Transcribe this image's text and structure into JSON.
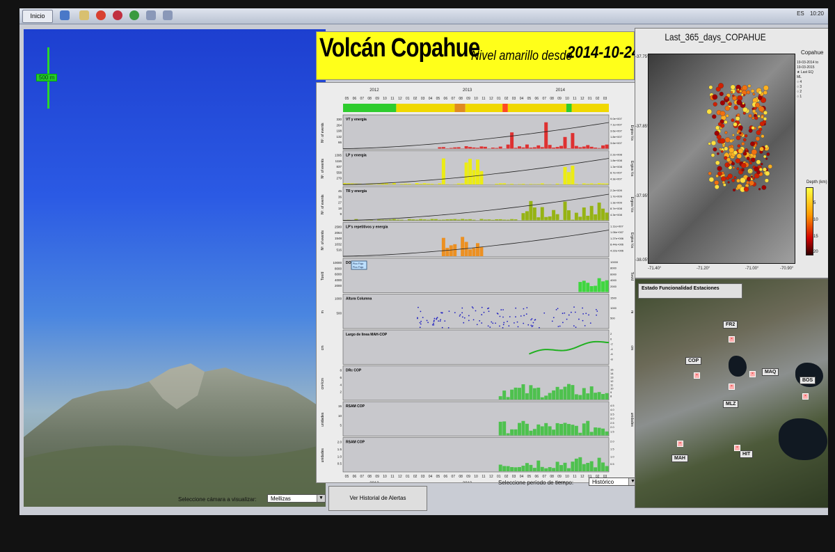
{
  "taskbar": {
    "start_label": "Inicio",
    "lang": "ES",
    "clock": "10:20"
  },
  "camera": {
    "scale_label": "500 m",
    "select_label": "Seleccione cámara a visualizar:",
    "select_value": "Mellizas"
  },
  "header": {
    "title": "Volcán Copahue",
    "subtitle": "Nivel amarillo desde",
    "date": "2014-10-24"
  },
  "controls": {
    "history_button": "Ver Historial de Alertas",
    "period_label": "Seleccione período de tiempo:",
    "period_value": "Histórico"
  },
  "chart_data": {
    "type": "line",
    "years_top": [
      "2012",
      "2013",
      "2014"
    ],
    "months_top": [
      "05",
      "06",
      "07",
      "08",
      "09",
      "10",
      "11",
      "12",
      "01",
      "02",
      "03",
      "04",
      "05",
      "06",
      "07",
      "08",
      "09",
      "10",
      "11",
      "12",
      "01",
      "02",
      "03",
      "04",
      "05",
      "06",
      "07",
      "08",
      "09",
      "10",
      "11",
      "12",
      "01",
      "02",
      "03"
    ],
    "alert_band": {
      "colors": [
        "#2ecc2e",
        "#f0d800",
        "#e08a20",
        "#f0d800",
        "#ff4a20",
        "#f0d800",
        "#2ecc2e",
        "#f0d800"
      ],
      "widths": [
        0.2,
        0.22,
        0.04,
        0.14,
        0.02,
        0.22,
        0.02,
        0.14
      ]
    },
    "panels": [
      {
        "label": "VT y energía",
        "ylabel": "Nº. of events",
        "yticks": [
          "330",
          "264",
          "198",
          "132",
          "66"
        ],
        "rticks": [
          "9.0e+007",
          "7.1e+007",
          "3.6e+007",
          "1.8e+007",
          "3.6e+007"
        ],
        "rlabel": "Ergios ½s",
        "color": "#e02020",
        "pattern": "spikes_right",
        "cumulative": true
      },
      {
        "label": "LP y energía",
        "ylabel": "Nº. of events",
        "yticks": [
          "1395",
          "1116",
          "837",
          "558",
          "279"
        ],
        "rticks": [
          "2.2e+008",
          "1.8e+008",
          "1.3e+008",
          "8.7e+007",
          "4.3e+007"
        ],
        "rlabel": "Ergios ½s",
        "color": "#f0f000",
        "pattern": "bursts_mid",
        "cumulative": true
      },
      {
        "label": "TR y energía",
        "ylabel": "Nº. of events",
        "yticks": [
          "45",
          "36",
          "27",
          "18",
          "9"
        ],
        "rticks": [
          "2.2e+009",
          "1.7e+009",
          "1.3e+009",
          "8.7e+008",
          "4.3e+008"
        ],
        "rlabel": "Ergios ½s",
        "color": "#90b000",
        "pattern": "late_bursts",
        "cumulative": true
      },
      {
        "label": "LP's repetitivos y energía",
        "ylabel": "Nº. of events",
        "yticks": [
          "2580",
          "2064",
          "1548",
          "1032",
          "516"
        ],
        "rticks": [
          "1.11e+007",
          "1.06e+007",
          "1.27e+006",
          "8.44e+006",
          "4.22e+006"
        ],
        "rlabel": "Ergios ½s",
        "color": "#f08a10",
        "pattern": "orange_mid",
        "cumulative": true
      },
      {
        "label": "DOAS",
        "ylabel": "Ton/d",
        "yticks": [
          "10000",
          "8000",
          "6000",
          "4000",
          "2000"
        ],
        "rticks": [
          "10000",
          "8000",
          "6000",
          "4000",
          "2000"
        ],
        "rlabel": "Ton/d",
        "color": "#30d830",
        "pattern": "doas",
        "cumulative": false,
        "legend": [
          "Pico Flujo",
          "Pico Flujo"
        ]
      },
      {
        "label": "Altura Columna",
        "ylabel": "m",
        "yticks": [
          "1000",
          "500"
        ],
        "rticks": [
          "1500",
          "1000",
          "500"
        ],
        "rlabel": "m",
        "color": "#2020c0",
        "pattern": "column",
        "cumulative": false
      },
      {
        "label": "Largo de linea MAH-COP",
        "ylabel": "cm",
        "yticks": [],
        "rticks": [
          "2",
          "0",
          "-2",
          "-4",
          "-6",
          "-8"
        ],
        "rlabel": "cm",
        "color": "#20b020",
        "pattern": "line_trend",
        "cumulative": false
      },
      {
        "label": "DRc COP",
        "ylabel": "cm²/cm",
        "yticks": [
          "8",
          "6",
          "4",
          "2"
        ],
        "rticks": [
          "15",
          "14",
          "13",
          "12",
          "11",
          "10",
          "9",
          "8"
        ],
        "rlabel": "",
        "color": "#40c040",
        "pattern": "drc",
        "cumulative": false
      },
      {
        "label": "RSAM COP",
        "ylabel": "unidades",
        "yticks": [
          "15",
          "10",
          "5"
        ],
        "rticks": [
          "4.5",
          "4.0",
          "3.5",
          "3.0",
          "2.5",
          "2.0",
          "1.5"
        ],
        "rlabel": "unidades",
        "color": "#40c040",
        "pattern": "rsam",
        "cumulative": false
      },
      {
        "label": "RSAM COP",
        "ylabel": "unidades",
        "yticks": [
          "2.0",
          "1.5",
          "1.0",
          "0.5"
        ],
        "rticks": [
          "2.0",
          "1.5",
          "1.0",
          "0.5"
        ],
        "rlabel": "",
        "color": "#40c040",
        "pattern": "rsam2",
        "cumulative": false
      }
    ],
    "years_bottom": [
      "2012",
      "2013",
      "2014"
    ],
    "months_bottom": [
      "05",
      "06",
      "07",
      "08",
      "09",
      "10",
      "11",
      "12",
      "01",
      "02",
      "03",
      "04",
      "05",
      "06",
      "07",
      "08",
      "09",
      "10",
      "11",
      "12",
      "01",
      "02",
      "03",
      "04",
      "05",
      "06",
      "07",
      "08",
      "09",
      "10",
      "11",
      "12",
      "01",
      "02",
      "03"
    ]
  },
  "map_epicenters": {
    "title": "Last_365_days_COPAHUE",
    "legend_title": "Copahue",
    "legend_lines": [
      "19-03-2014 to",
      "19-03-2015",
      "★ Last EQ",
      "ML",
      "○ 4",
      "○ 3",
      "○ 2",
      "○ 1"
    ],
    "colorbar_title": "Depth (km)",
    "colorbar_ticks": [
      "5",
      "10",
      "15",
      "20"
    ],
    "lat_ticks": [
      "-37.75°",
      "-37.85°",
      "-37.95°",
      "-38.05°"
    ],
    "lon_ticks": [
      "-71.40°",
      "-71.20°",
      "-71.00°",
      "-70.90°"
    ]
  },
  "map_stations": {
    "title": "Estado Funcionalidad Estaciones",
    "stations": [
      {
        "name": "FR2"
      },
      {
        "name": "COP"
      },
      {
        "name": "MAQ"
      },
      {
        "name": "BOS"
      },
      {
        "name": "MLZ"
      },
      {
        "name": "MAH"
      },
      {
        "name": "HIT"
      }
    ]
  }
}
